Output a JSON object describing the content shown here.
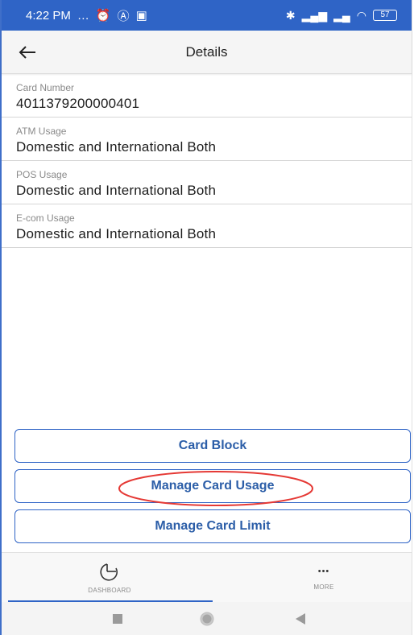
{
  "status_bar": {
    "time": "4:22 PM",
    "left_icons": [
      "…",
      "⏰",
      "Ⓐ",
      "▣"
    ],
    "right_icons": [
      "✱",
      "▂▄▆",
      "▂▄",
      "◠"
    ],
    "battery": "57"
  },
  "header": {
    "title": "Details"
  },
  "details": [
    {
      "label": "Card Number",
      "value": "4011379200000401"
    },
    {
      "label": "ATM Usage",
      "value": "Domestic and International Both"
    },
    {
      "label": "POS Usage",
      "value": "Domestic and International Both"
    },
    {
      "label": "E-com Usage",
      "value": "Domestic and International Both"
    }
  ],
  "actions": {
    "card_block": "Card Block",
    "manage_usage": "Manage Card Usage",
    "manage_limit": "Manage Card Limit"
  },
  "bottom_nav": {
    "dashboard": "DASHBOARD",
    "more": "MORE",
    "more_icon_glyph": "•••"
  },
  "colors": {
    "primary": "#2f64c6",
    "button_text": "#2c5ea8",
    "highlight_ellipse": "#e53935"
  }
}
